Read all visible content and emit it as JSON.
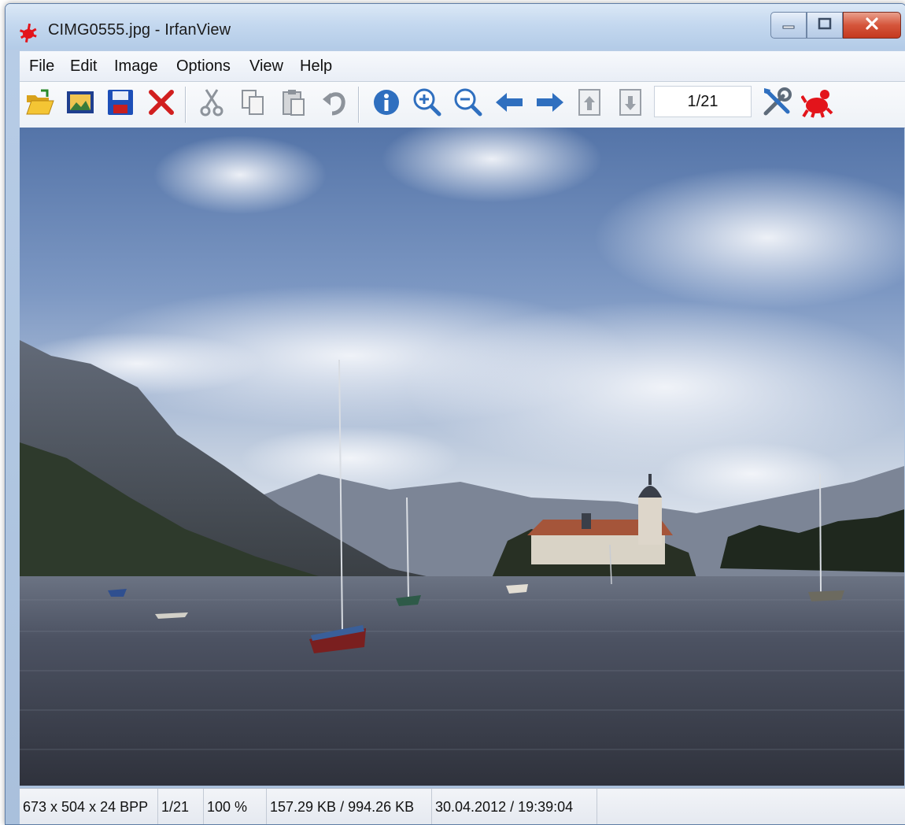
{
  "window": {
    "title": "CIMG0555.jpg - IrfanView"
  },
  "menu": {
    "items": [
      {
        "label": "File"
      },
      {
        "label": "Edit"
      },
      {
        "label": "Image"
      },
      {
        "label": "Options"
      },
      {
        "label": "View"
      },
      {
        "label": "Help"
      }
    ]
  },
  "toolbar": {
    "page_counter": "1/21",
    "icons": [
      "open-folder-icon",
      "slideshow-icon",
      "save-icon",
      "delete-icon",
      "cut-icon",
      "copy-icon",
      "paste-icon",
      "undo-icon",
      "info-icon",
      "zoom-in-icon",
      "zoom-out-icon",
      "previous-icon",
      "next-icon",
      "page-up-icon",
      "page-down-icon",
      "settings-icon",
      "irfanview-logo-icon"
    ]
  },
  "statusbar": {
    "dimensions": "673 x 504 x 24 BPP",
    "position": "1/21",
    "zoom": "100 %",
    "filesize": "157.29 KB / 994.26 KB",
    "datetime": "30.04.2012 / 19:39:04"
  },
  "colors": {
    "titlebar": "#c4d8ef",
    "accent_blue": "#2f6fbf",
    "delete_red": "#d11f1f",
    "close_button": "#d5553b"
  }
}
